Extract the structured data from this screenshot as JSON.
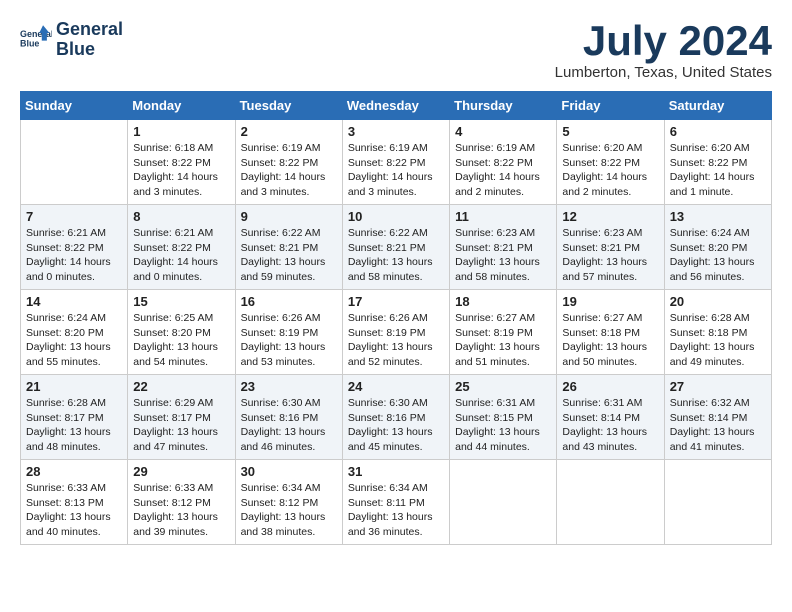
{
  "header": {
    "logo_line1": "General",
    "logo_line2": "Blue",
    "month_title": "July 2024",
    "location": "Lumberton, Texas, United States"
  },
  "days_of_week": [
    "Sunday",
    "Monday",
    "Tuesday",
    "Wednesday",
    "Thursday",
    "Friday",
    "Saturday"
  ],
  "weeks": [
    [
      {
        "day": "",
        "content": ""
      },
      {
        "day": "1",
        "content": "Sunrise: 6:18 AM\nSunset: 8:22 PM\nDaylight: 14 hours\nand 3 minutes."
      },
      {
        "day": "2",
        "content": "Sunrise: 6:19 AM\nSunset: 8:22 PM\nDaylight: 14 hours\nand 3 minutes."
      },
      {
        "day": "3",
        "content": "Sunrise: 6:19 AM\nSunset: 8:22 PM\nDaylight: 14 hours\nand 3 minutes."
      },
      {
        "day": "4",
        "content": "Sunrise: 6:19 AM\nSunset: 8:22 PM\nDaylight: 14 hours\nand 2 minutes."
      },
      {
        "day": "5",
        "content": "Sunrise: 6:20 AM\nSunset: 8:22 PM\nDaylight: 14 hours\nand 2 minutes."
      },
      {
        "day": "6",
        "content": "Sunrise: 6:20 AM\nSunset: 8:22 PM\nDaylight: 14 hours\nand 1 minute."
      }
    ],
    [
      {
        "day": "7",
        "content": "Sunrise: 6:21 AM\nSunset: 8:22 PM\nDaylight: 14 hours\nand 0 minutes."
      },
      {
        "day": "8",
        "content": "Sunrise: 6:21 AM\nSunset: 8:22 PM\nDaylight: 14 hours\nand 0 minutes."
      },
      {
        "day": "9",
        "content": "Sunrise: 6:22 AM\nSunset: 8:21 PM\nDaylight: 13 hours\nand 59 minutes."
      },
      {
        "day": "10",
        "content": "Sunrise: 6:22 AM\nSunset: 8:21 PM\nDaylight: 13 hours\nand 58 minutes."
      },
      {
        "day": "11",
        "content": "Sunrise: 6:23 AM\nSunset: 8:21 PM\nDaylight: 13 hours\nand 58 minutes."
      },
      {
        "day": "12",
        "content": "Sunrise: 6:23 AM\nSunset: 8:21 PM\nDaylight: 13 hours\nand 57 minutes."
      },
      {
        "day": "13",
        "content": "Sunrise: 6:24 AM\nSunset: 8:20 PM\nDaylight: 13 hours\nand 56 minutes."
      }
    ],
    [
      {
        "day": "14",
        "content": "Sunrise: 6:24 AM\nSunset: 8:20 PM\nDaylight: 13 hours\nand 55 minutes."
      },
      {
        "day": "15",
        "content": "Sunrise: 6:25 AM\nSunset: 8:20 PM\nDaylight: 13 hours\nand 54 minutes."
      },
      {
        "day": "16",
        "content": "Sunrise: 6:26 AM\nSunset: 8:19 PM\nDaylight: 13 hours\nand 53 minutes."
      },
      {
        "day": "17",
        "content": "Sunrise: 6:26 AM\nSunset: 8:19 PM\nDaylight: 13 hours\nand 52 minutes."
      },
      {
        "day": "18",
        "content": "Sunrise: 6:27 AM\nSunset: 8:19 PM\nDaylight: 13 hours\nand 51 minutes."
      },
      {
        "day": "19",
        "content": "Sunrise: 6:27 AM\nSunset: 8:18 PM\nDaylight: 13 hours\nand 50 minutes."
      },
      {
        "day": "20",
        "content": "Sunrise: 6:28 AM\nSunset: 8:18 PM\nDaylight: 13 hours\nand 49 minutes."
      }
    ],
    [
      {
        "day": "21",
        "content": "Sunrise: 6:28 AM\nSunset: 8:17 PM\nDaylight: 13 hours\nand 48 minutes."
      },
      {
        "day": "22",
        "content": "Sunrise: 6:29 AM\nSunset: 8:17 PM\nDaylight: 13 hours\nand 47 minutes."
      },
      {
        "day": "23",
        "content": "Sunrise: 6:30 AM\nSunset: 8:16 PM\nDaylight: 13 hours\nand 46 minutes."
      },
      {
        "day": "24",
        "content": "Sunrise: 6:30 AM\nSunset: 8:16 PM\nDaylight: 13 hours\nand 45 minutes."
      },
      {
        "day": "25",
        "content": "Sunrise: 6:31 AM\nSunset: 8:15 PM\nDaylight: 13 hours\nand 44 minutes."
      },
      {
        "day": "26",
        "content": "Sunrise: 6:31 AM\nSunset: 8:14 PM\nDaylight: 13 hours\nand 43 minutes."
      },
      {
        "day": "27",
        "content": "Sunrise: 6:32 AM\nSunset: 8:14 PM\nDaylight: 13 hours\nand 41 minutes."
      }
    ],
    [
      {
        "day": "28",
        "content": "Sunrise: 6:33 AM\nSunset: 8:13 PM\nDaylight: 13 hours\nand 40 minutes."
      },
      {
        "day": "29",
        "content": "Sunrise: 6:33 AM\nSunset: 8:12 PM\nDaylight: 13 hours\nand 39 minutes."
      },
      {
        "day": "30",
        "content": "Sunrise: 6:34 AM\nSunset: 8:12 PM\nDaylight: 13 hours\nand 38 minutes."
      },
      {
        "day": "31",
        "content": "Sunrise: 6:34 AM\nSunset: 8:11 PM\nDaylight: 13 hours\nand 36 minutes."
      },
      {
        "day": "",
        "content": ""
      },
      {
        "day": "",
        "content": ""
      },
      {
        "day": "",
        "content": ""
      }
    ]
  ]
}
